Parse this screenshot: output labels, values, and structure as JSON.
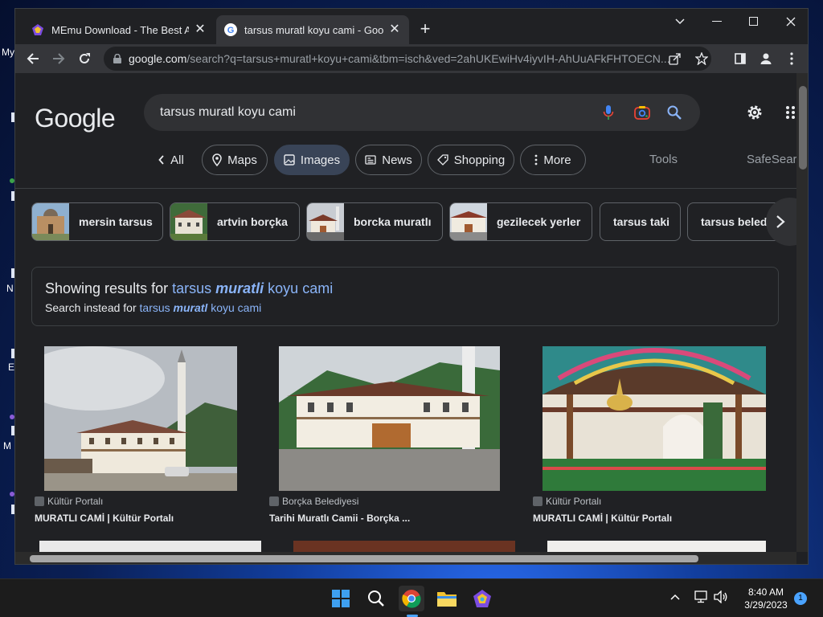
{
  "desktop": {
    "labels": [
      "My",
      "N",
      "E",
      "M"
    ]
  },
  "browser": {
    "tabs": [
      {
        "title": "MEmu Download - The Best Andr",
        "close": "✕"
      },
      {
        "title": "tarsus muratl koyu cami - Google",
        "close": "✕"
      }
    ],
    "new_tab": "+",
    "url_host": "google.com",
    "url_rest": "/search?q=tarsus+muratl+koyu+cami&tbm=isch&ved=2ahUKEwiHv4iyvIH-AhUuAFkFHTOECN..."
  },
  "search": {
    "logo": "Google",
    "query": "tarsus muratl koyu cami"
  },
  "nav": {
    "all": "All",
    "maps": "Maps",
    "images": "Images",
    "news": "News",
    "shopping": "Shopping",
    "more": "More",
    "tools": "Tools",
    "safesearch": "SafeSearch"
  },
  "related": [
    {
      "label": "mersin tarsus"
    },
    {
      "label": "artvin borçka"
    },
    {
      "label": "borcka muratlı"
    },
    {
      "label": "gezilecek yerler"
    },
    {
      "label": "tarsus taki"
    },
    {
      "label": "tarsus beledi"
    }
  ],
  "spelling": {
    "showing_prefix": "Showing results for",
    "showing_q1": "tarsus",
    "showing_q2": "muratli",
    "showing_q3": "koyu cami",
    "instead_prefix": "Search instead for",
    "instead_q1": "tarsus",
    "instead_q2": "muratl",
    "instead_q3": "koyu cami"
  },
  "results": [
    {
      "source": "Kültür Portalı",
      "title": "MURATLI CAMİ | Kültür Portalı"
    },
    {
      "source": "Borçka Belediyesi",
      "title": "Tarihi Muratlı Camii - Borçka ..."
    },
    {
      "source": "Kültür Portalı",
      "title": "MURATLI CAMİ | Kültür Portalı"
    }
  ],
  "taskbar": {
    "time": "8:40 AM",
    "date": "3/29/2023",
    "notifications": "1"
  }
}
